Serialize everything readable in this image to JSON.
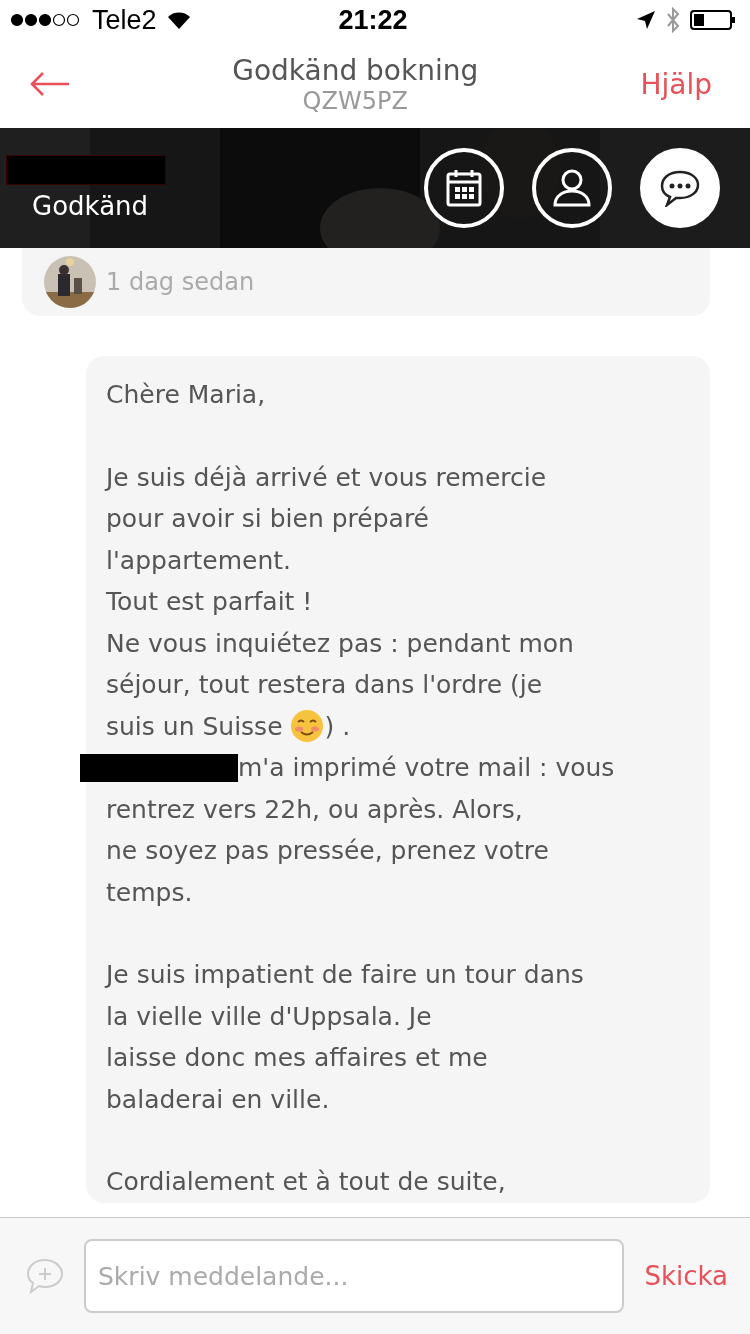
{
  "status_bar": {
    "carrier": "Tele2",
    "time": "21:22"
  },
  "nav": {
    "title": "Godkänd bokning",
    "subtitle": "QZW5PZ",
    "action": "Hjälp"
  },
  "banner": {
    "status": "Godkänd",
    "tabs": [
      {
        "kind": "calendar",
        "selected": false
      },
      {
        "kind": "person",
        "selected": false
      },
      {
        "kind": "chat",
        "selected": true
      }
    ]
  },
  "messages": [
    {
      "time": "1 dag sedan"
    },
    {
      "paragraphs": [
        [
          {
            "kind": "text",
            "text": "Chère Maria,"
          }
        ],
        [
          {
            "kind": "text",
            "text": "Je suis déjà arrivé et vous remercie"
          },
          {
            "kind": "text",
            "text": "pour avoir si bien préparé"
          },
          {
            "kind": "text",
            "text": "l'appartement."
          },
          {
            "kind": "text",
            "text": "Tout est parfait !"
          },
          {
            "kind": "text",
            "text": "Ne vous inquiétez pas :  pendant mon"
          },
          {
            "kind": "text",
            "text": "séjour, tout restera dans l'ordre (je"
          },
          {
            "kind": "emoji",
            "text": "suis un Suisse",
            "after": ") ."
          },
          {
            "kind": "redacted",
            "text": "m'a imprimé votre mail : vous"
          },
          {
            "kind": "text",
            "text": "rentrez vers 22h, ou après. Alors,"
          },
          {
            "kind": "text",
            "text": "ne soyez pas pressée, prenez votre"
          },
          {
            "kind": "text",
            "text": "temps."
          }
        ],
        [
          {
            "kind": "text",
            "text": "Je suis impatient de faire un tour dans"
          },
          {
            "kind": "text",
            "text": "la vielle ville d'Uppsala. Je"
          },
          {
            "kind": "text",
            "text": "laisse donc mes affaires et me"
          },
          {
            "kind": "text",
            "text": "baladerai en ville."
          }
        ],
        [
          {
            "kind": "text",
            "text": "Cordialement et à tout de suite,"
          }
        ]
      ]
    }
  ],
  "composer": {
    "placeholder": "Skriv meddelande...",
    "send": "Skicka"
  }
}
